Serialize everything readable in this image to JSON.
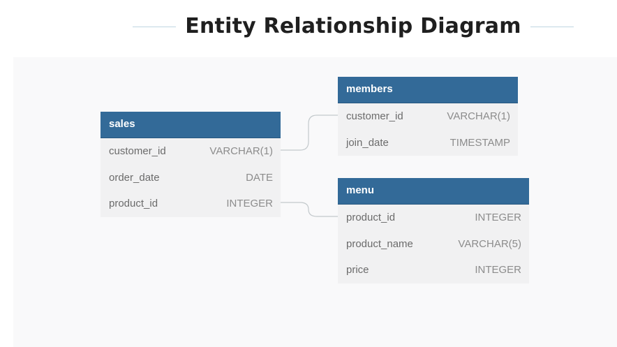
{
  "title": "Entity Relationship Diagram",
  "entities": {
    "sales": {
      "name": "sales",
      "columns": [
        {
          "name": "customer_id",
          "type": "VARCHAR(1)"
        },
        {
          "name": "order_date",
          "type": "DATE"
        },
        {
          "name": "product_id",
          "type": "INTEGER"
        }
      ]
    },
    "members": {
      "name": "members",
      "columns": [
        {
          "name": "customer_id",
          "type": "VARCHAR(1)"
        },
        {
          "name": "join_date",
          "type": "TIMESTAMP"
        }
      ]
    },
    "menu": {
      "name": "menu",
      "columns": [
        {
          "name": "product_id",
          "type": "INTEGER"
        },
        {
          "name": "product_name",
          "type": "VARCHAR(5)"
        },
        {
          "name": "price",
          "type": "INTEGER"
        }
      ]
    }
  },
  "relationships": [
    {
      "from": "sales.customer_id",
      "to": "members.customer_id"
    },
    {
      "from": "sales.product_id",
      "to": "menu.product_id"
    }
  ],
  "colors": {
    "header_bg": "#336a98",
    "header_text": "#ffffff",
    "table_bg": "#f1f1f2",
    "canvas_bg": "#f9f9fa",
    "connector": "#c3c9cc",
    "title_rule": "#bfd6e2"
  }
}
